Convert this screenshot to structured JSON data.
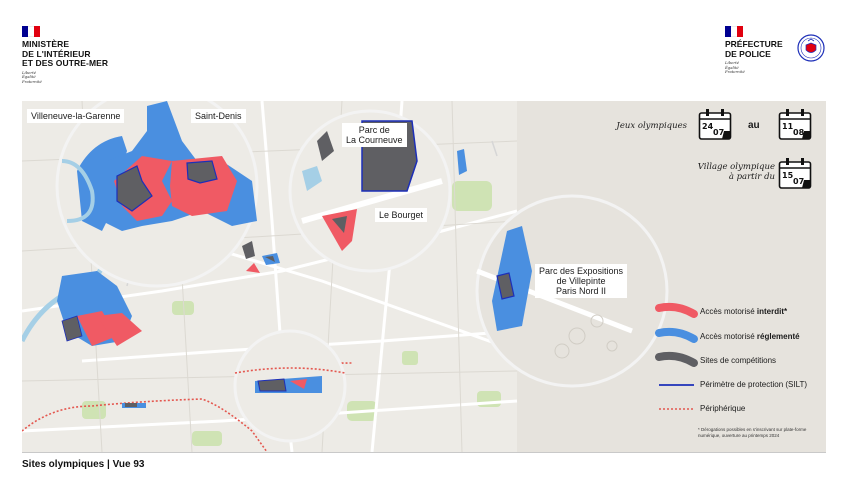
{
  "header": {
    "ministry": "MINISTÈRE\nDE L'INTÉRIEUR\nET DES OUTRE-MER",
    "ministry_motto": "Liberté\nÉgalité\nFraternité",
    "prefecture": "PRÉFECTURE\nDE POLICE",
    "prefecture_motto": "Liberté\nÉgalité\nFraternité",
    "flag_colors": [
      "#000091",
      "#ffffff",
      "#e1000f"
    ],
    "logo_icon": "prefecture-de-police-badge-icon"
  },
  "map": {
    "base_color": "#edebe6",
    "circle_labels": {
      "villeneuve": "Villeneuve-la-Garenne",
      "saint_denis": "Saint-Denis",
      "courneuve": "Parc de\nLa Courneuve",
      "bourget": "Le Bourget",
      "villepinte": "Parc des Expositions\nde Villepinte\nParis Nord II"
    }
  },
  "calendar": {
    "jeux_label": "Jeux olympiques",
    "start_day": "24",
    "start_month": "07",
    "au_label": "au",
    "end_day": "11",
    "end_month": "08",
    "village_label": "Village olympique\nà partir du",
    "village_day": "15",
    "village_month": "07",
    "icon": "calendar-icon"
  },
  "legend": {
    "forbidden_prefix": "Accès motorisé ",
    "forbidden_bold": "interdit*",
    "regulated_prefix": "Accès motorisé ",
    "regulated_bold": "réglementé",
    "sites": "Sites de compétitions",
    "perimeter": "Périmètre de protection (SILT)",
    "peripherique": "Périphérique",
    "colors": {
      "forbidden": "#f05a64",
      "regulated": "#4a8fe0",
      "sites": "#5f5f63",
      "perimeter": "#1d2fb8",
      "peripherique": "#e4574f"
    }
  },
  "footnote": "* Dérogations possibles en s'inscrivant sur plate-forme numérique, ouverture au printemps 2024",
  "footer": {
    "title": "Sites olympiques | Vue 93"
  }
}
